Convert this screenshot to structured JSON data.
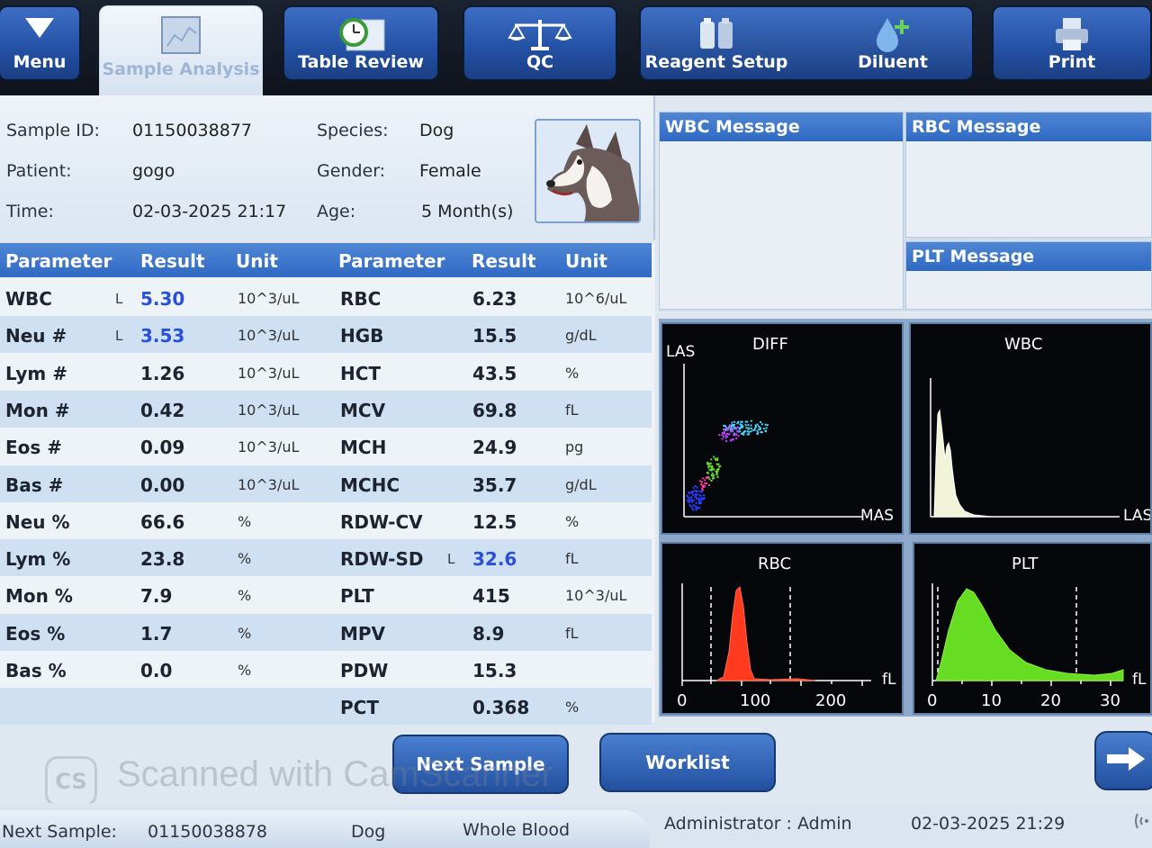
{
  "toolbar": {
    "menu": "Menu",
    "sample_analysis": "Sample Analysis",
    "table_review": "Table Review",
    "qc": "QC",
    "reagent_setup": "Reagent Setup",
    "diluent": "Diluent",
    "print": "Print"
  },
  "patient": {
    "sample_id_label": "Sample ID:",
    "sample_id": "01150038877",
    "patient_label": "Patient:",
    "patient": "gogo",
    "time_label": "Time:",
    "time": "02-03-2025 21:17",
    "species_label": "Species:",
    "species": "Dog",
    "gender_label": "Gender:",
    "gender": "Female",
    "age_label": "Age:",
    "age": "5 Month(s)"
  },
  "table": {
    "headers": [
      "Parameter",
      "Result",
      "Unit",
      "Parameter",
      "Result",
      "Unit"
    ],
    "left": [
      {
        "param": "WBC",
        "flag": "L",
        "result": "5.30",
        "unit": "10^3/uL",
        "low": true
      },
      {
        "param": "Neu #",
        "flag": "L",
        "result": "3.53",
        "unit": "10^3/uL",
        "low": true
      },
      {
        "param": "Lym #",
        "flag": "",
        "result": "1.26",
        "unit": "10^3/uL",
        "low": false
      },
      {
        "param": "Mon #",
        "flag": "",
        "result": "0.42",
        "unit": "10^3/uL",
        "low": false
      },
      {
        "param": "Eos #",
        "flag": "",
        "result": "0.09",
        "unit": "10^3/uL",
        "low": false
      },
      {
        "param": "Bas #",
        "flag": "",
        "result": "0.00",
        "unit": "10^3/uL",
        "low": false
      },
      {
        "param": "Neu %",
        "flag": "",
        "result": "66.6",
        "unit": "%",
        "low": false
      },
      {
        "param": "Lym %",
        "flag": "",
        "result": "23.8",
        "unit": "%",
        "low": false
      },
      {
        "param": "Mon %",
        "flag": "",
        "result": "7.9",
        "unit": "%",
        "low": false
      },
      {
        "param": "Eos %",
        "flag": "",
        "result": "1.7",
        "unit": "%",
        "low": false
      },
      {
        "param": "Bas %",
        "flag": "",
        "result": "0.0",
        "unit": "%",
        "low": false
      }
    ],
    "right": [
      {
        "param": "RBC",
        "flag": "",
        "result": "6.23",
        "unit": "10^6/uL",
        "low": false
      },
      {
        "param": "HGB",
        "flag": "",
        "result": "15.5",
        "unit": "g/dL",
        "low": false
      },
      {
        "param": "HCT",
        "flag": "",
        "result": "43.5",
        "unit": "%",
        "low": false
      },
      {
        "param": "MCV",
        "flag": "",
        "result": "69.8",
        "unit": "fL",
        "low": false
      },
      {
        "param": "MCH",
        "flag": "",
        "result": "24.9",
        "unit": "pg",
        "low": false
      },
      {
        "param": "MCHC",
        "flag": "",
        "result": "35.7",
        "unit": "g/dL",
        "low": false
      },
      {
        "param": "RDW-CV",
        "flag": "",
        "result": "12.5",
        "unit": "%",
        "low": false
      },
      {
        "param": "RDW-SD",
        "flag": "L",
        "result": "32.6",
        "unit": "fL",
        "low": true
      },
      {
        "param": "PLT",
        "flag": "",
        "result": "415",
        "unit": "10^3/uL",
        "low": false
      },
      {
        "param": "MPV",
        "flag": "",
        "result": "8.9",
        "unit": "fL",
        "low": false
      },
      {
        "param": "PDW",
        "flag": "",
        "result": "15.3",
        "unit": "",
        "low": false
      },
      {
        "param": "PCT",
        "flag": "",
        "result": "0.368",
        "unit": "%",
        "low": false
      }
    ]
  },
  "messages": {
    "wbc": "WBC Message",
    "rbc": "RBC Message",
    "plt": "PLT Message"
  },
  "graphs": {
    "diff": {
      "title": "DIFF",
      "y_label": "LAS",
      "x_label": "MAS"
    },
    "wbc": {
      "title": "WBC",
      "x_label": "LAS"
    },
    "rbc": {
      "title": "RBC",
      "unit": "fL",
      "ticks": [
        "0",
        "100",
        "200"
      ]
    },
    "plt": {
      "title": "PLT",
      "unit": "fL",
      "ticks": [
        "0",
        "10",
        "20",
        "30"
      ]
    }
  },
  "buttons": {
    "next_sample": "Next Sample",
    "worklist": "Worklist"
  },
  "watermark": {
    "logo": "CS",
    "text": "Scanned with CamScanner"
  },
  "status": {
    "next_sample_label": "Next Sample:",
    "next_sample_id": "01150038878",
    "species": "Dog",
    "sample_type": "Whole Blood",
    "user": "Administrator : Admin",
    "datetime": "02-03-2025 21:29"
  },
  "colors": {
    "accent": "#2f69c3",
    "low_flag": "#2a50d8",
    "rbc_curve": "#ff3a1e",
    "plt_curve": "#66dd22"
  }
}
